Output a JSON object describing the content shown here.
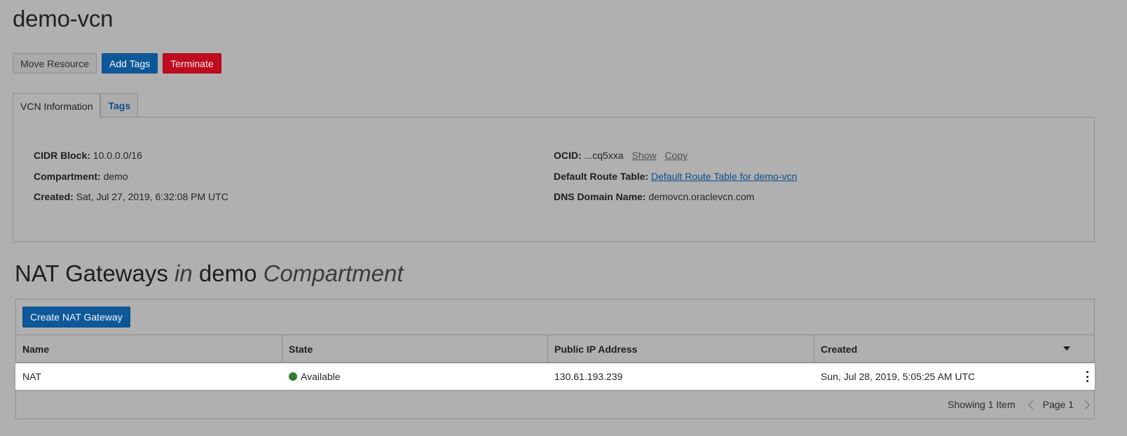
{
  "page": {
    "title": "demo-vcn"
  },
  "actions": {
    "move_resource": "Move Resource",
    "add_tags": "Add Tags",
    "terminate": "Terminate"
  },
  "tabs": [
    {
      "label": "VCN Information",
      "active": true
    },
    {
      "label": "Tags",
      "active": false
    }
  ],
  "info": {
    "cidr_label": "CIDR Block:",
    "cidr_value": "10.0.0.0/16",
    "compartment_label": "Compartment:",
    "compartment_value": "demo",
    "created_label": "Created:",
    "created_value": "Sat, Jul 27, 2019, 6:32:08 PM UTC",
    "ocid_label": "OCID:",
    "ocid_value": "...cq5xxa",
    "ocid_show": "Show",
    "ocid_copy": "Copy",
    "route_label": "Default Route Table:",
    "route_value": "Default Route Table for demo-vcn",
    "dns_label": "DNS Domain Name:",
    "dns_value": "demovcn.oraclevcn.com"
  },
  "nat_section": {
    "title_main": "NAT Gateways",
    "title_in": "in",
    "title_compartment": "demo",
    "title_suffix": "Compartment",
    "create_button": "Create NAT Gateway",
    "columns": [
      "Name",
      "State",
      "Public IP Address",
      "Created"
    ],
    "rows": [
      {
        "name": "NAT",
        "state": "Available",
        "state_color": "#2f7d31",
        "public_ip": "130.61.193.239",
        "created": "Sun, Jul 28, 2019, 5:05:25 AM UTC"
      }
    ],
    "showing": "Showing 1 Item",
    "page": "Page 1"
  },
  "colors": {
    "background": "#b0b0b0",
    "primary": "#0e5899",
    "danger": "#be0b1f",
    "link": "#0c4f8d"
  }
}
